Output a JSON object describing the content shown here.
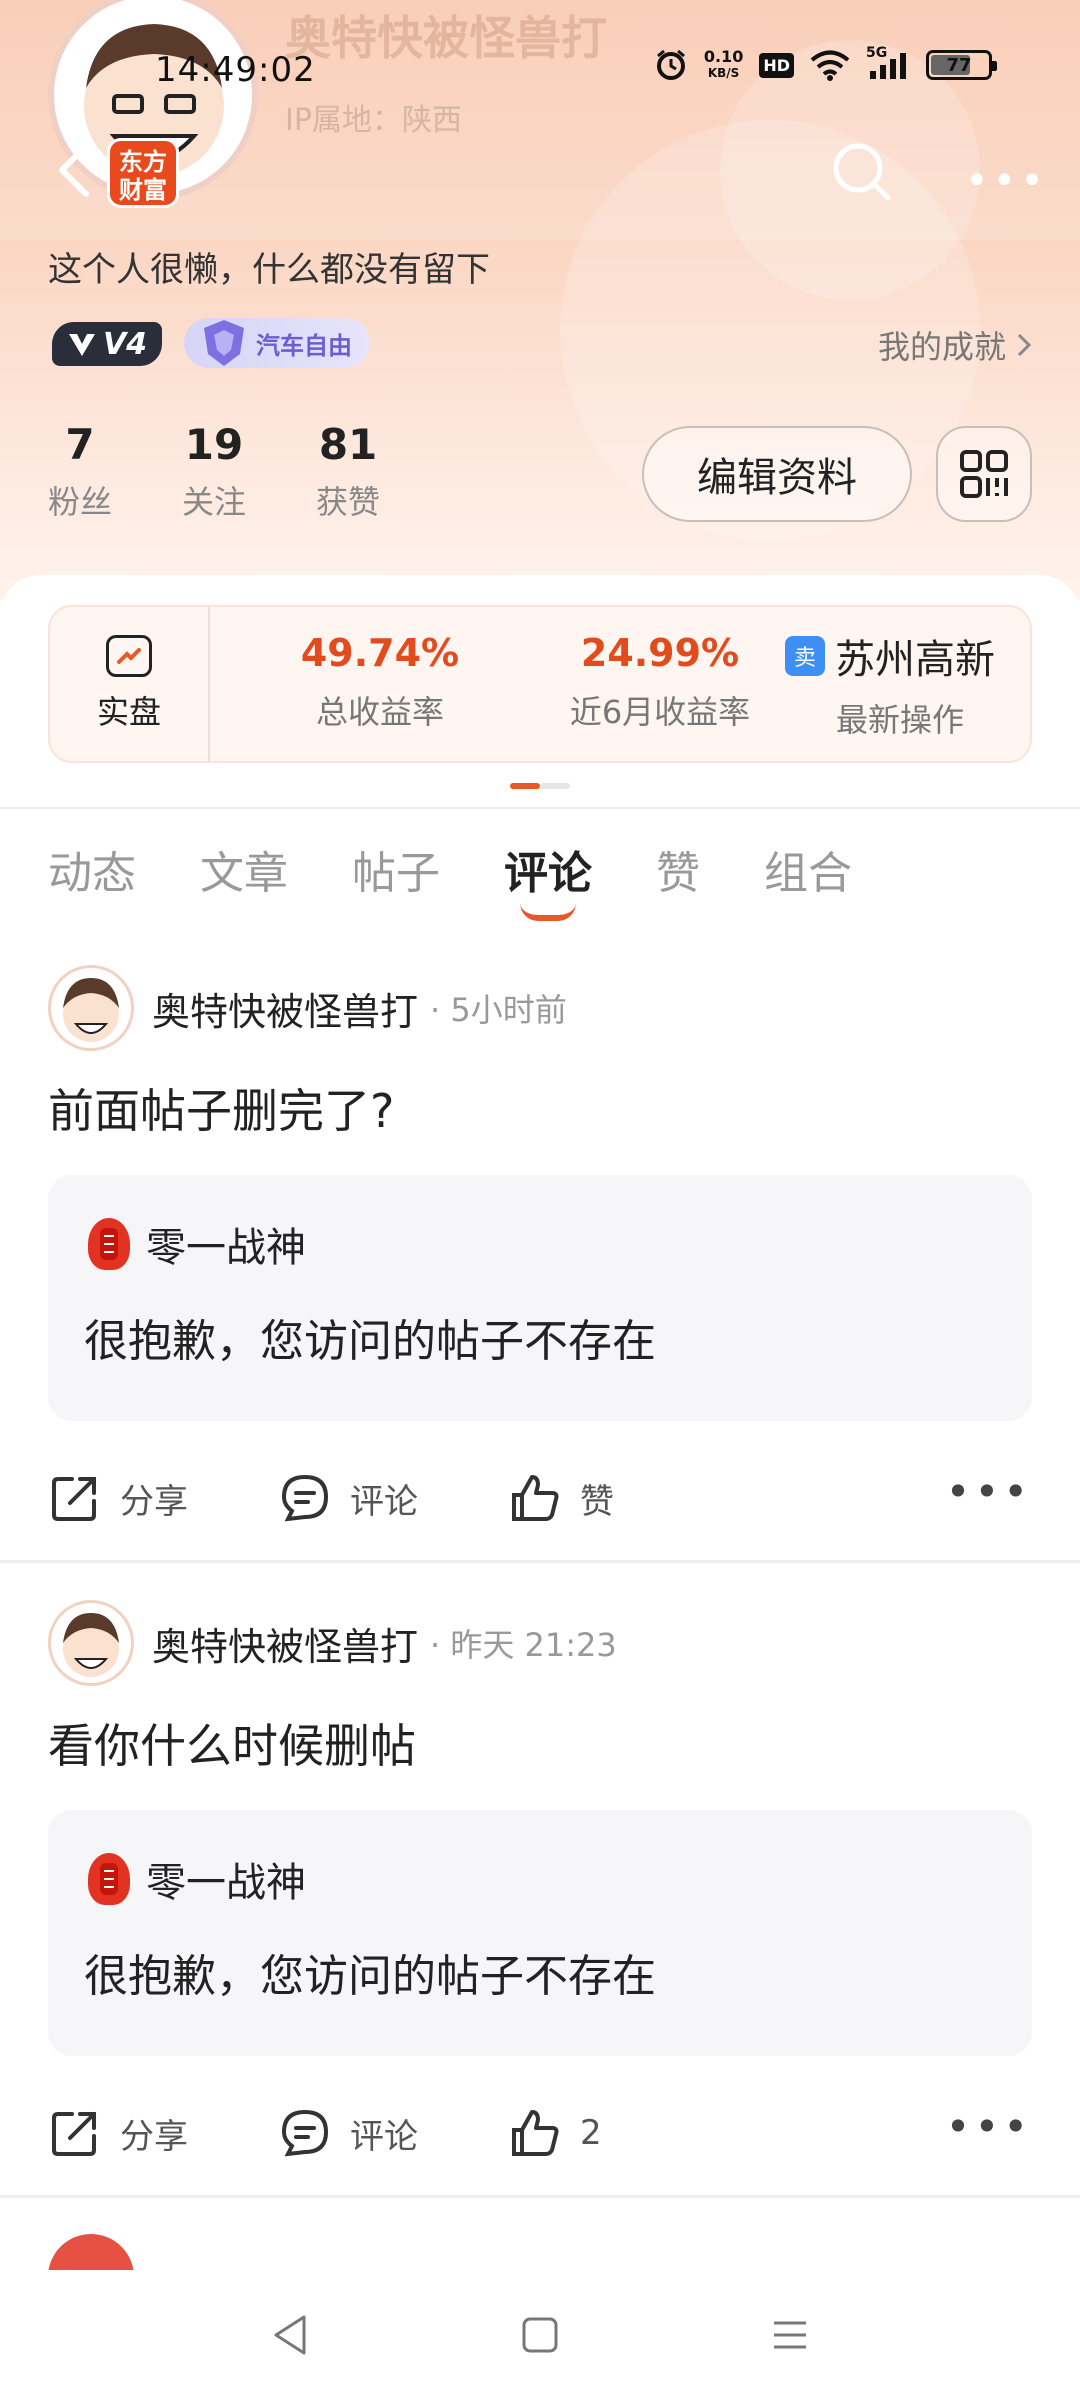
{
  "status_bar": {
    "time": "14:49:02",
    "net_speed": "0.10",
    "net_unit": "KB/S",
    "hd": "HD",
    "signal": "5G",
    "battery": "77"
  },
  "profile": {
    "brand_badge": "东方\n财富",
    "username": "奥特快被怪兽打",
    "ip_location": "IP属地：陕西",
    "bio": "这个人很懒，什么都没有留下",
    "level": "V4",
    "medal": "汽车自由",
    "achievements": "我的成就",
    "stats": [
      {
        "value": "7",
        "label": "粉丝"
      },
      {
        "value": "19",
        "label": "关注"
      },
      {
        "value": "81",
        "label": "获赞"
      }
    ],
    "edit_button": "编辑资料"
  },
  "performance": {
    "left_label": "实盘",
    "total_return": "49.74%",
    "total_return_label": "总收益率",
    "six_month_return": "24.99%",
    "six_month_label": "近6月收益率",
    "latest_tag": "卖",
    "latest_stock": "苏州高新",
    "latest_label": "最新操作"
  },
  "tabs": [
    "动态",
    "文章",
    "帖子",
    "评论",
    "赞",
    "组合"
  ],
  "active_tab": "评论",
  "comments": [
    {
      "user": "奥特快被怪兽打",
      "time": "· 5小时前",
      "text": "前面帖子删完了?",
      "quote_user": "零一战神",
      "quote_text": "很抱歉，您访问的帖子不存在",
      "share": "分享",
      "comment": "评论",
      "like": "赞"
    },
    {
      "user": "奥特快被怪兽打",
      "time": "· 昨天 21:23",
      "text": "看你什么时候删帖",
      "quote_user": "零一战神",
      "quote_text": "很抱歉，您访问的帖子不存在",
      "share": "分享",
      "comment": "评论",
      "like": "2"
    }
  ],
  "colors": {
    "accent": "#e8592a",
    "return_red": "#e24b1e",
    "header_peach": "#f9c7ae"
  }
}
